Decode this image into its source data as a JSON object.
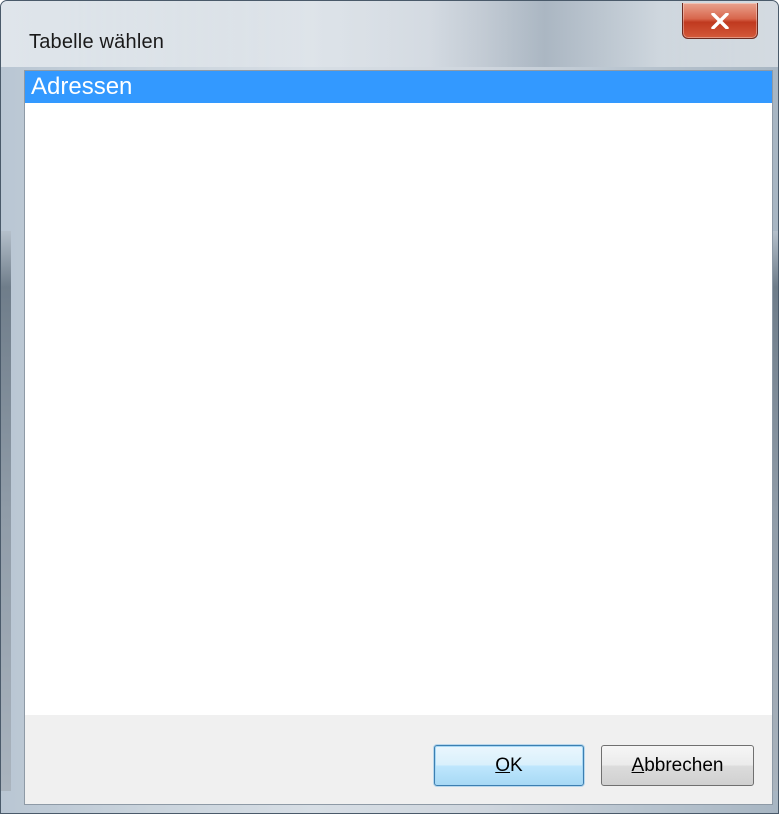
{
  "window": {
    "title": "Tabelle wählen",
    "close_icon": "close-x-icon"
  },
  "list": {
    "items": [
      {
        "label": "Adressen",
        "selected": true
      }
    ]
  },
  "buttons": {
    "ok": {
      "mnemonic": "O",
      "rest": "K",
      "label": "OK"
    },
    "cancel": {
      "mnemonic": "A",
      "rest": "bbrechen",
      "label": "Abbrechen"
    }
  },
  "colors": {
    "selection": "#3399ff",
    "close_button": "#c7402a",
    "default_button_border": "#3c7fb1"
  }
}
